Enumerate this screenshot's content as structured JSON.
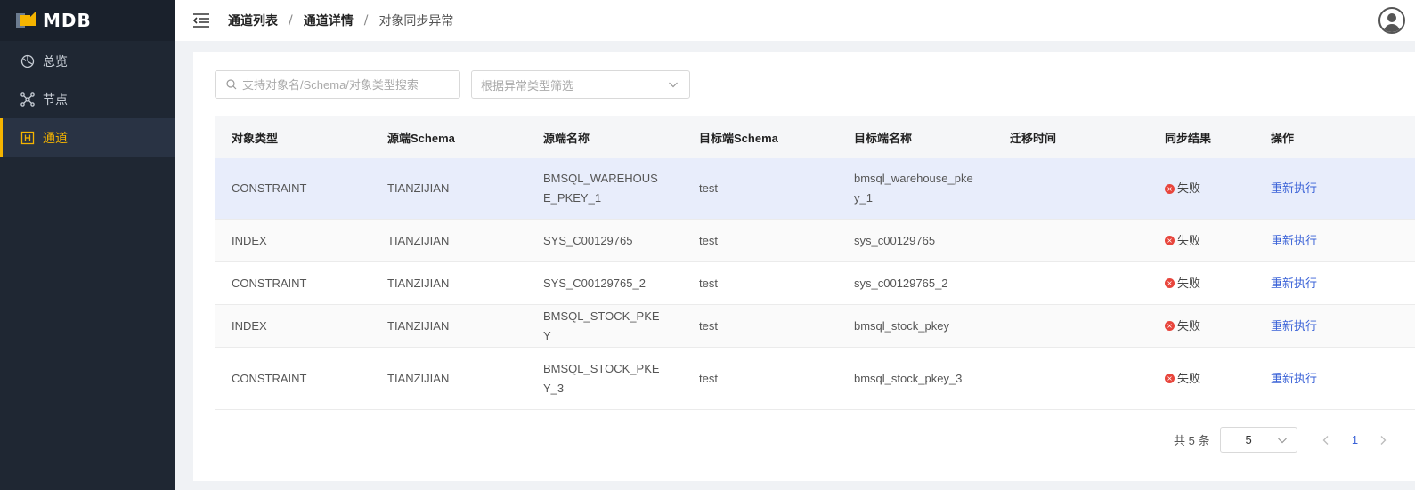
{
  "app": {
    "logo_text": "MDB"
  },
  "sidebar": {
    "items": [
      {
        "label": "总览",
        "icon": "dashboard-icon",
        "active": false
      },
      {
        "label": "节点",
        "icon": "nodes-icon",
        "active": false
      },
      {
        "label": "通道",
        "icon": "channel-icon",
        "active": true
      }
    ]
  },
  "header": {
    "breadcrumb": [
      "通道列表",
      "通道详情",
      "对象同步异常"
    ],
    "separator": "/"
  },
  "filters": {
    "search_placeholder": "支持对象名/Schema/对象类型搜索",
    "type_filter_placeholder": "根据异常类型筛选"
  },
  "table": {
    "columns": [
      "对象类型",
      "源端Schema",
      "源端名称",
      "目标端Schema",
      "目标端名称",
      "迁移时间",
      "同步结果",
      "操作"
    ],
    "rows": [
      {
        "type": "CONSTRAINT",
        "src_schema": "TIANZIJIAN",
        "src_name": "BMSQL_WAREHOUSE_PKEY_1",
        "dst_schema": "test",
        "dst_name": "bmsql_warehouse_pkey_1",
        "time": "",
        "result": "失败",
        "action": "重新执行"
      },
      {
        "type": "INDEX",
        "src_schema": "TIANZIJIAN",
        "src_name": "SYS_C00129765",
        "dst_schema": "test",
        "dst_name": "sys_c00129765",
        "time": "",
        "result": "失败",
        "action": "重新执行"
      },
      {
        "type": "CONSTRAINT",
        "src_schema": "TIANZIJIAN",
        "src_name": "SYS_C00129765_2",
        "dst_schema": "test",
        "dst_name": "sys_c00129765_2",
        "time": "",
        "result": "失败",
        "action": "重新执行"
      },
      {
        "type": "INDEX",
        "src_schema": "TIANZIJIAN",
        "src_name": "BMSQL_STOCK_PKEY",
        "dst_schema": "test",
        "dst_name": "bmsql_stock_pkey",
        "time": "",
        "result": "失败",
        "action": "重新执行"
      },
      {
        "type": "CONSTRAINT",
        "src_schema": "TIANZIJIAN",
        "src_name": "BMSQL_STOCK_PKEY_3",
        "dst_schema": "test",
        "dst_name": "bmsql_stock_pkey_3",
        "time": "",
        "result": "失败",
        "action": "重新执行"
      }
    ]
  },
  "pagination": {
    "total_text": "共 5 条",
    "page_size": "5",
    "current_page": "1"
  },
  "colors": {
    "accent": "#f5b400",
    "link": "#3a62d7",
    "error": "#e8453c",
    "sidebar_bg": "#1f2733"
  }
}
